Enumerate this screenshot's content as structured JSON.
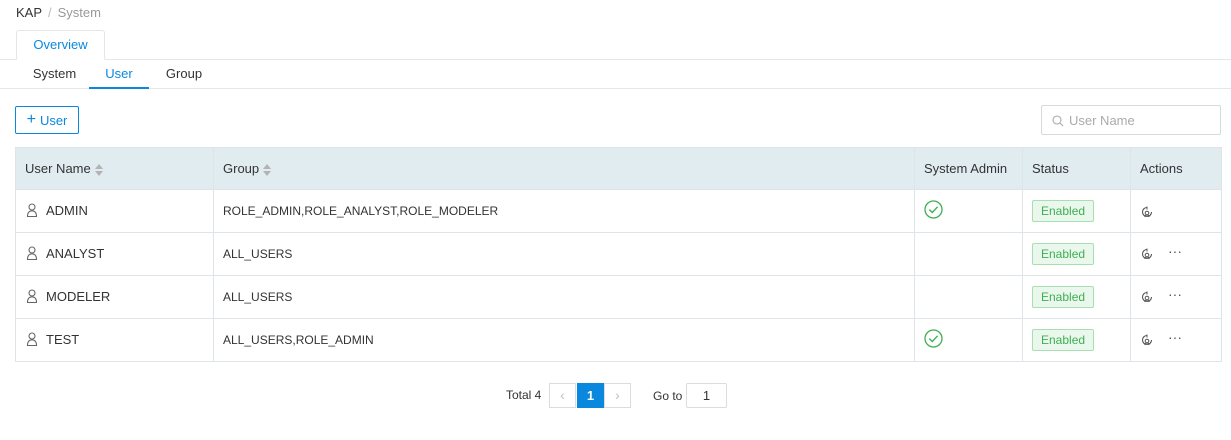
{
  "breadcrumb": {
    "root": "KAP",
    "separator": "/",
    "current": "System"
  },
  "top_tabs": [
    {
      "label": "Overview",
      "active": true
    }
  ],
  "sub_tabs": [
    {
      "label": "System",
      "active": false
    },
    {
      "label": "User",
      "active": true
    },
    {
      "label": "Group",
      "active": false
    }
  ],
  "toolbar": {
    "add_user_label": "User",
    "add_icon": "plus-icon"
  },
  "search": {
    "placeholder": "User Name",
    "value": "",
    "icon": "search-icon"
  },
  "table": {
    "columns": [
      {
        "label": "User Name",
        "sortable": true
      },
      {
        "label": "Group",
        "sortable": true
      },
      {
        "label": "System Admin",
        "sortable": false
      },
      {
        "label": "Status",
        "sortable": false
      },
      {
        "label": "Actions",
        "sortable": false
      }
    ],
    "rows": [
      {
        "user_name": "ADMIN",
        "group": "ROLE_ADMIN,ROLE_ANALYST,ROLE_MODELER",
        "system_admin": true,
        "status": "Enabled",
        "has_more": false
      },
      {
        "user_name": "ANALYST",
        "group": "ALL_USERS",
        "system_admin": false,
        "status": "Enabled",
        "has_more": true
      },
      {
        "user_name": "MODELER",
        "group": "ALL_USERS",
        "system_admin": false,
        "status": "Enabled",
        "has_more": true
      },
      {
        "user_name": "TEST",
        "group": "ALL_USERS,ROLE_ADMIN",
        "system_admin": true,
        "status": "Enabled",
        "has_more": true
      }
    ],
    "more_label": "···"
  },
  "pagination": {
    "total_label": "Total 4",
    "prev": "‹",
    "next": "›",
    "current_page": "1",
    "goto_label": "Go to",
    "goto_value": "1"
  },
  "colors": {
    "accent": "#0988de",
    "header_bg": "#e1ecf1",
    "status_green": "#3eaf52",
    "check_green": "#3eaf52"
  }
}
